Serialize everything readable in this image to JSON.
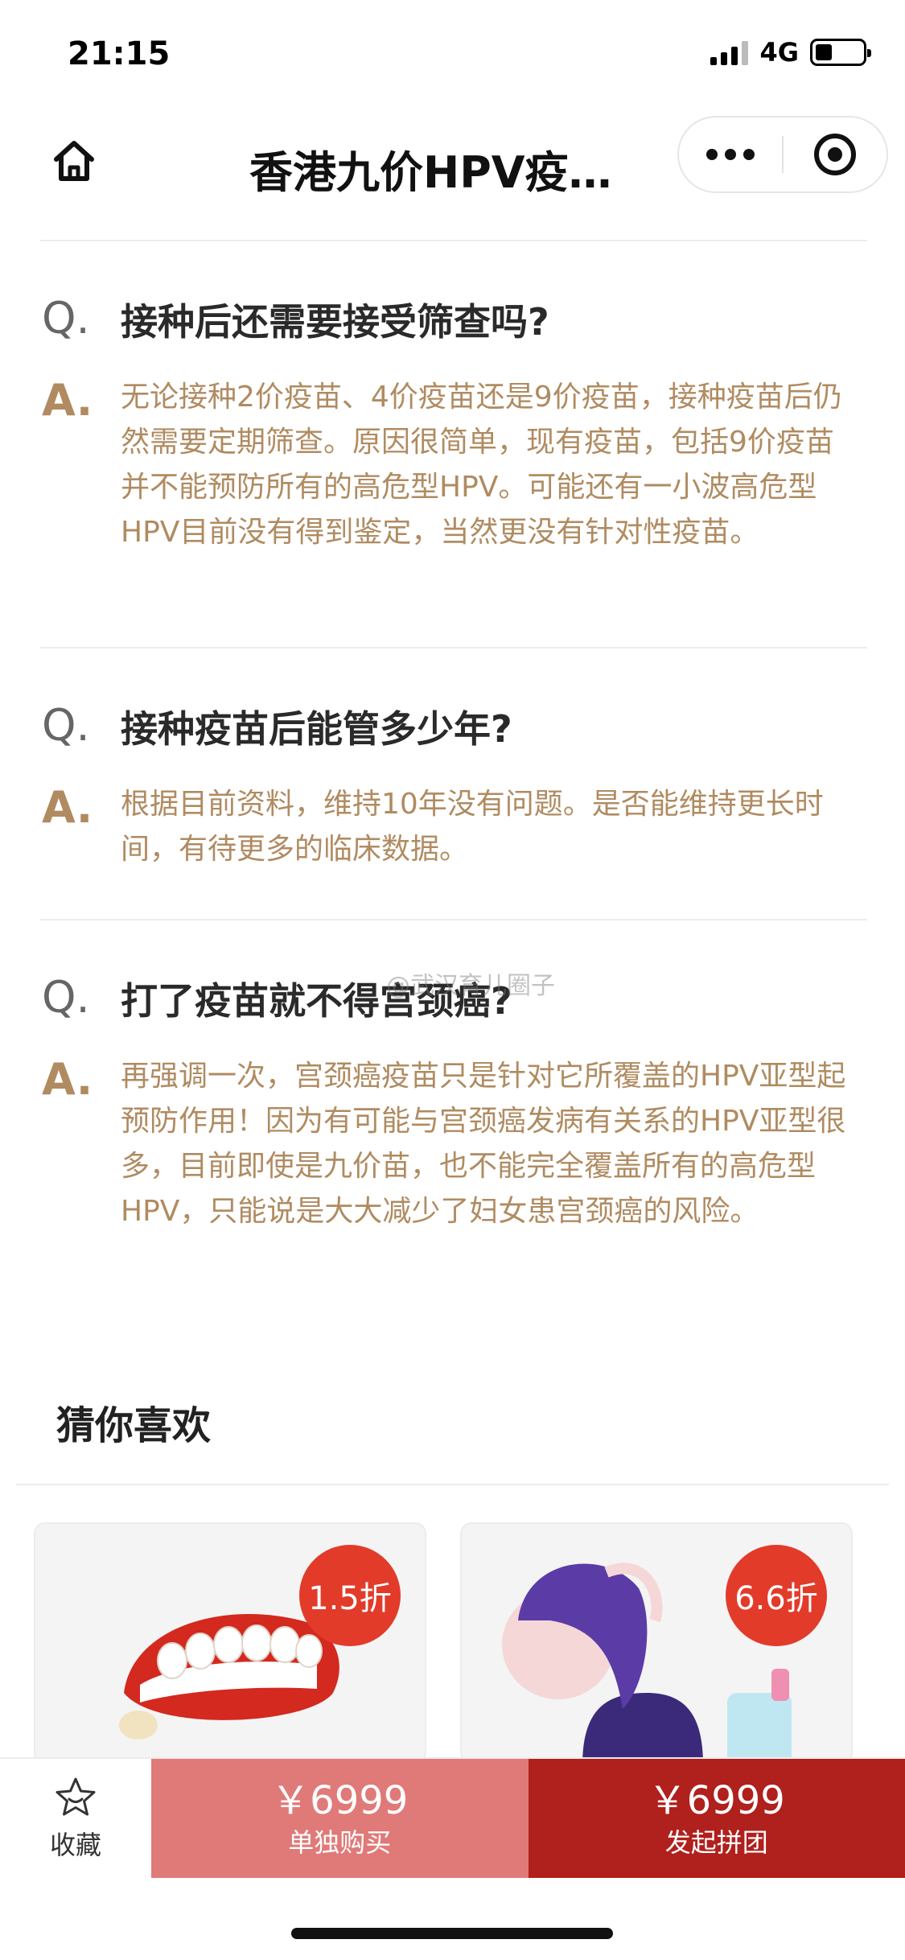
{
  "status_bar": {
    "time": "21:15",
    "network": "4G",
    "battery_level": 0.35
  },
  "nav": {
    "title": "香港九价HPV疫…"
  },
  "faq": [
    {
      "q_mark": "Q.",
      "question": "接种后还需要接受筛查吗?",
      "a_mark": "A.",
      "answer": "无论接种2价疫苗、4价疫苗还是9价疫苗，接种疫苗后仍然需要定期筛查。原因很简单，现有疫苗，包括9价疫苗并不能预防所有的高危型HPV。可能还有一小波高危型HPV目前没有得到鉴定，当然更没有针对性疫苗。"
    },
    {
      "q_mark": "Q.",
      "question": "接种疫苗后能管多少年?",
      "a_mark": "A.",
      "answer": "根据目前资料，维持10年没有问题。是否能维持更长时间，有待更多的临床数据。"
    },
    {
      "q_mark": "Q.",
      "question": "打了疫苗就不得宫颈癌?",
      "a_mark": "A.",
      "answer": "再强调一次，宫颈癌疫苗只是针对它所覆盖的HPV亚型起预防作用！因为有可能与宫颈癌发病有关系的HPV亚型很多，目前即使是九价苗，也不能完全覆盖所有的高危型HPV，只能说是大大减少了妇女患宫颈癌的风险。"
    }
  ],
  "watermark": "@武汉育儿圈子",
  "recommend": {
    "title": "猜你喜欢",
    "items": [
      {
        "badge": "1.5折",
        "image": "teeth-toy"
      },
      {
        "badge": "6.6折",
        "image": "woman-spray"
      }
    ]
  },
  "bottom_bar": {
    "favorite_label": "收藏",
    "solo": {
      "price": "￥6999",
      "label": "单独购买"
    },
    "group": {
      "price": "￥6999",
      "label": "发起拼团"
    }
  },
  "colors": {
    "answer": "#b08b61",
    "badge": "#e23b2a",
    "solo_button": "#e07a78",
    "group_button": "#b0201c"
  }
}
